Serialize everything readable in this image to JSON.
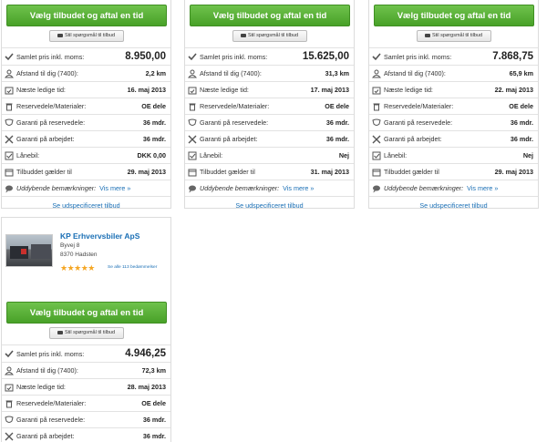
{
  "labels": {
    "choose": "Vælg tilbudet og aftal en tid",
    "ask": "Stil spørgsmål til tilbud",
    "total": "Samlet pris inkl. moms:",
    "distance": "Afstand til dig (7400):",
    "next": "Næste ledige tid:",
    "parts": "Reservedele/Materialer:",
    "warranty_parts": "Garanti på reservedele:",
    "warranty_work": "Garanti på arbejdet:",
    "loan_car": "Lånebil:",
    "valid": "Tilbuddet gælder til",
    "remarks": "Uddybende bemærkninger:",
    "see_more": "Vis mere »",
    "spec": "Se udspecificeret tilbud"
  },
  "offers": [
    {
      "total": "8.950,00",
      "distance": "2,2 km",
      "next": "16. maj 2013",
      "parts": "OE dele",
      "warranty_parts": "36 mdr.",
      "warranty_work": "36 mdr.",
      "loan_car": "DKK 0,00",
      "valid": "29. maj 2013"
    },
    {
      "total": "15.625,00",
      "distance": "31,3 km",
      "next": "17. maj 2013",
      "parts": "OE dele",
      "warranty_parts": "36 mdr.",
      "warranty_work": "36 mdr.",
      "loan_car": "Nej",
      "valid": "31. maj 2013"
    },
    {
      "total": "7.868,75",
      "distance": "65,9 km",
      "next": "22. maj 2013",
      "parts": "OE dele",
      "warranty_parts": "36 mdr.",
      "warranty_work": "36 mdr.",
      "loan_car": "Nej",
      "valid": "29. maj 2013"
    },
    {
      "total": "4.946,25",
      "distance": "72,3 km",
      "next": "28. maj 2013",
      "parts": "OE dele",
      "warranty_parts": "36 mdr.",
      "warranty_work": "36 mdr."
    }
  ],
  "company": {
    "name": "KP Erhvervsbiler ApS",
    "street": "Byvej 8",
    "city": "8370 Hadsten",
    "stars": "★★★★★",
    "rating": 5,
    "reviews": "Se alle 113 bedømmelser"
  },
  "icons": {
    "total": "checkmark-icon",
    "distance": "person-icon",
    "next": "calendar-icon",
    "parts": "trash-icon",
    "warranty_parts": "shield-icon",
    "warranty_work": "tools-icon",
    "loan_car": "checkbox-icon",
    "valid": "calendar-icon",
    "remarks": "speech-bubble-icon"
  },
  "colors": {
    "accent_green": "#5cb33a",
    "link_blue": "#1a6fb5",
    "star": "#f5a623"
  }
}
